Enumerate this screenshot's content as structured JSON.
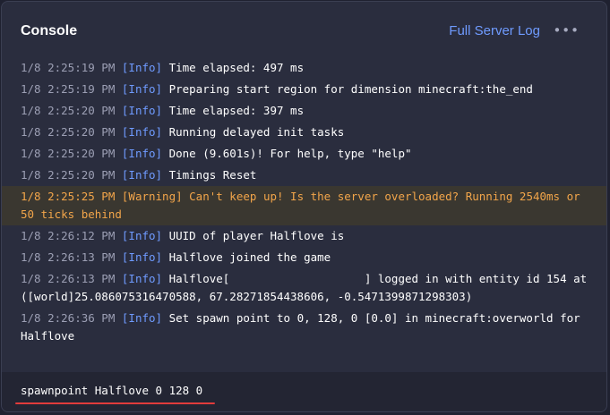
{
  "header": {
    "title": "Console",
    "full_log_label": "Full Server Log",
    "more_label": "•••"
  },
  "log": [
    {
      "ts": "1/8 2:25:19 PM",
      "tag": "[Info]",
      "msg": "Time elapsed: 497 ms",
      "level": "info"
    },
    {
      "ts": "1/8 2:25:19 PM",
      "tag": "[Info]",
      "msg": "Preparing start region for dimension minecraft:the_end",
      "level": "info"
    },
    {
      "ts": "1/8 2:25:20 PM",
      "tag": "[Info]",
      "msg": "Time elapsed: 397 ms",
      "level": "info"
    },
    {
      "ts": "1/8 2:25:20 PM",
      "tag": "[Info]",
      "msg": "Running delayed init tasks",
      "level": "info"
    },
    {
      "ts": "1/8 2:25:20 PM",
      "tag": "[Info]",
      "msg": "Done (9.601s)! For help, type \"help\"",
      "level": "info"
    },
    {
      "ts": "1/8 2:25:20 PM",
      "tag": "[Info]",
      "msg": "Timings Reset",
      "level": "info"
    },
    {
      "ts": "1/8 2:25:25 PM",
      "tag": "[Warning]",
      "msg": "Can't keep up! Is the server overloaded? Running 2540ms or 50 ticks behind",
      "level": "warning"
    },
    {
      "ts": "1/8 2:26:12 PM",
      "tag": "[Info]",
      "msg": "UUID of player Halflove is\n",
      "level": "info"
    },
    {
      "ts": "1/8 2:26:13 PM",
      "tag": "[Info]",
      "msg": "Halflove joined the game",
      "level": "info"
    },
    {
      "ts": "1/8 2:26:13 PM",
      "tag": "[Info]",
      "msg": "Halflove[                    ] logged in with entity id 154 at ([world]25.086075316470588, 67.28271854438606, -0.5471399871298303)",
      "level": "info"
    },
    {
      "ts": "1/8 2:26:36 PM",
      "tag": "[Info]",
      "msg": "Set spawn point to 0, 128, 0 [0.0] in minecraft:overworld for Halflove",
      "level": "info"
    }
  ],
  "command": {
    "value": "spawnpoint Halflove 0 128 0"
  },
  "colors": {
    "accent": "#6f9bff",
    "warning": "#f2a54a",
    "timestamp": "#9c9fb4",
    "highlight_underline": "#e23b3b"
  }
}
